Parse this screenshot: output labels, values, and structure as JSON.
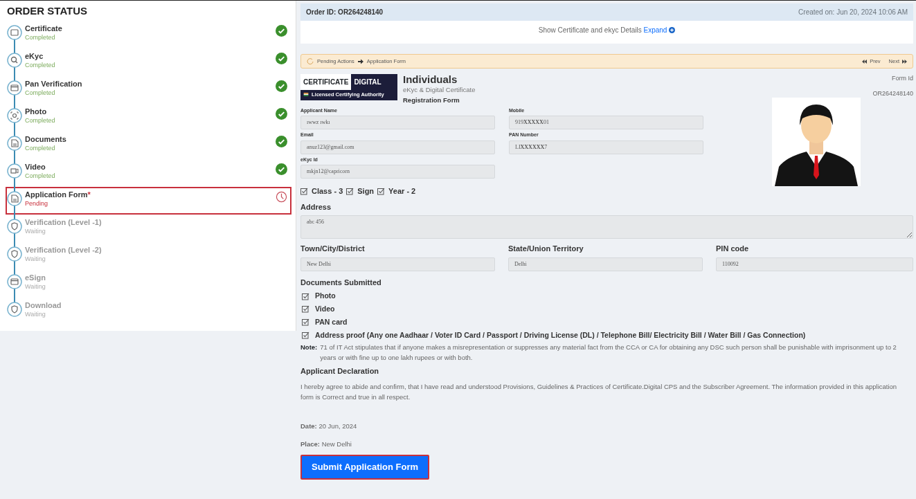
{
  "sidebar": {
    "title": "ORDER STATUS",
    "steps": [
      {
        "label": "Certificate",
        "status_text": "Completed",
        "kind": "completed",
        "highlighted": false
      },
      {
        "label": "eKyc",
        "status_text": "Completed",
        "kind": "completed",
        "highlighted": false
      },
      {
        "label": "Pan Verification",
        "status_text": "Completed",
        "kind": "completed",
        "highlighted": false
      },
      {
        "label": "Photo",
        "status_text": "Completed",
        "kind": "completed",
        "highlighted": false
      },
      {
        "label": "Documents",
        "status_text": "Completed",
        "kind": "completed",
        "highlighted": false
      },
      {
        "label": "Video",
        "status_text": "Completed",
        "kind": "completed",
        "highlighted": false
      },
      {
        "label": "Application Form",
        "marker": "*",
        "status_text": "Pending",
        "kind": "pending",
        "highlighted": true
      },
      {
        "label": "Verification (Level -1)",
        "status_text": "Waiting",
        "kind": "waiting",
        "highlighted": false
      },
      {
        "label": "Verification (Level -2)",
        "status_text": "Waiting",
        "kind": "waiting",
        "highlighted": false
      },
      {
        "label": "eSign",
        "status_text": "Waiting",
        "kind": "waiting",
        "highlighted": false
      },
      {
        "label": "Download",
        "status_text": "Waiting",
        "kind": "waiting",
        "highlighted": false
      }
    ]
  },
  "order": {
    "id_text": "Order ID: OR264248140",
    "created": "Created on: Jun 20, 2024 10:06 AM",
    "details_text": "Show Certificate and ekyc Details",
    "expand_link": "Expand"
  },
  "pending_bar": {
    "label": "Pending Actions",
    "target": "Application Form",
    "prev": "Prev",
    "next": "Next"
  },
  "form": {
    "logo": {
      "word_1": "CERTIFICATE",
      "word_2": "DIGITAL",
      "tagline": "Licensed Certifying Authority"
    },
    "title": "Individuals",
    "subtitle": "eKyc & Digital Certificate",
    "subtitle_2": "Registration Form",
    "form_id_label": "Form Id",
    "form_id": "OR264248140",
    "fields": [
      {
        "label": "Applicant Name",
        "value": "ıwwz ıwkı"
      },
      {
        "label": "Mobile",
        "value": "919**XXXXX**01"
      },
      {
        "label": "Email",
        "value": "anuz123@gmail.com"
      },
      {
        "label": "PAN Number",
        "value": "LI**XXXXXX**7"
      },
      {
        "label": "eKyc Id",
        "value": "mkjn12@capricorn"
      }
    ],
    "options": [
      {
        "label": "Class - 3",
        "checked": true
      },
      {
        "label": "Sign",
        "checked": true
      },
      {
        "label": "Year - 2",
        "checked": true
      }
    ],
    "address_label": "Address",
    "address": "abc 456",
    "location_fields": [
      {
        "label": "Town/City/District",
        "value": "New Delhi"
      },
      {
        "label": "State/Union Territory",
        "value": "Delhi"
      },
      {
        "label": "PIN code",
        "value": "110092"
      }
    ],
    "documents_label": "Documents Submitted",
    "documents": [
      {
        "label": "Photo",
        "checked": true
      },
      {
        "label": "Video",
        "checked": true
      },
      {
        "label": "PAN card",
        "checked": true
      },
      {
        "label": "Address proof (Any one Aadhaar / Voter ID Card / Passport / Driving License (DL) / Telephone Bill/ Electricity Bill / Water Bill / Gas Connection)",
        "checked": true
      }
    ],
    "note_label": "Note:",
    "note": "71 of IT Act stipulates that if anyone makes a misrepresentation or suppresses any material fact from the CCA or CA for obtaining any DSC such person shall be punishable with imprisonment up to 2 years or with fine up to one lakh rupees or with both.",
    "declaration_label": "Applicant Declaration",
    "declaration": "I hereby agree to abide and confirm, that I have read and understood Provisions, Guidelines & Practices of Certificate.Digital CPS and the Subscriber Agreement. The information provided in this application form is Correct and true in all respect.",
    "date": "**Date:** 20 Jun, 2024",
    "place": "**Place:** New Delhi",
    "submit": "Submit Application Form"
  }
}
